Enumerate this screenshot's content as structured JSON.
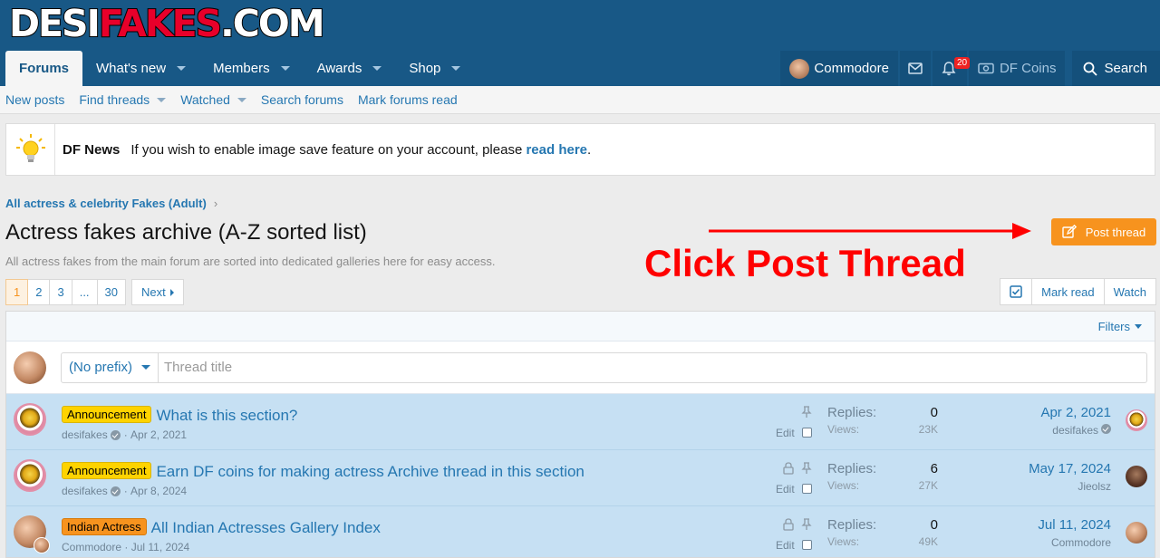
{
  "brand": {
    "part1": "DESI",
    "part2": "FAKES",
    "part3": ".COM"
  },
  "nav": {
    "tabs": [
      {
        "label": "Forums",
        "active": true
      },
      {
        "label": "What's new"
      },
      {
        "label": "Members"
      },
      {
        "label": "Awards"
      },
      {
        "label": "Shop"
      }
    ],
    "user": "Commodore",
    "alerts_count": "20",
    "coins_label": "DF Coins",
    "search_label": "Search"
  },
  "subnav": [
    "New posts",
    "Find threads",
    "Watched",
    "Search forums",
    "Mark forums read"
  ],
  "notice": {
    "title": "DF News",
    "text": "If you wish to enable image save feature on your account, please ",
    "link": "read here",
    "tail": "."
  },
  "breadcrumb": "All actress & celebrity Fakes (Adult)",
  "page": {
    "title": "Actress fakes archive (A-Z sorted list)",
    "description": "All actress fakes from the main forum are sorted into dedicated galleries here for easy access.",
    "annotation": "Click Post Thread",
    "post_button": "Post thread"
  },
  "pager": {
    "pages": [
      "1",
      "2",
      "3",
      "...",
      "30"
    ],
    "next": "Next"
  },
  "actions": {
    "mark_read": "Mark read",
    "watch": "Watch"
  },
  "filters_label": "Filters",
  "quick_thread": {
    "prefix": "(No prefix)",
    "placeholder": "Thread title"
  },
  "threads": [
    {
      "prefix": "Announcement",
      "title": "What is this section?",
      "author": "desifakes",
      "date": "Apr 2, 2021",
      "replies": "0",
      "views": "23K",
      "last_date": "Apr 2, 2021",
      "last_user": "desifakes"
    },
    {
      "prefix": "Announcement",
      "title": "Earn DF coins for making actress Archive thread in this section",
      "author": "desifakes",
      "date": "Apr 8, 2024",
      "replies": "6",
      "views": "27K",
      "last_date": "May 17, 2024",
      "last_user": "Jieolsz"
    },
    {
      "prefix": "Indian Actress",
      "title": "All Indian Actresses Gallery Index",
      "author": "Commodore",
      "date": "Jul 11, 2024",
      "replies": "0",
      "views": "49K",
      "last_date": "Jul 11, 2024",
      "last_user": "Commodore"
    }
  ],
  "labels": {
    "replies": "Replies:",
    "views": "Views:",
    "edit": "Edit",
    "dot": "·"
  },
  "colors": {
    "header": "#185886",
    "accent": "#f7931e",
    "link": "#2577b1",
    "annotation": "#ff0000"
  }
}
